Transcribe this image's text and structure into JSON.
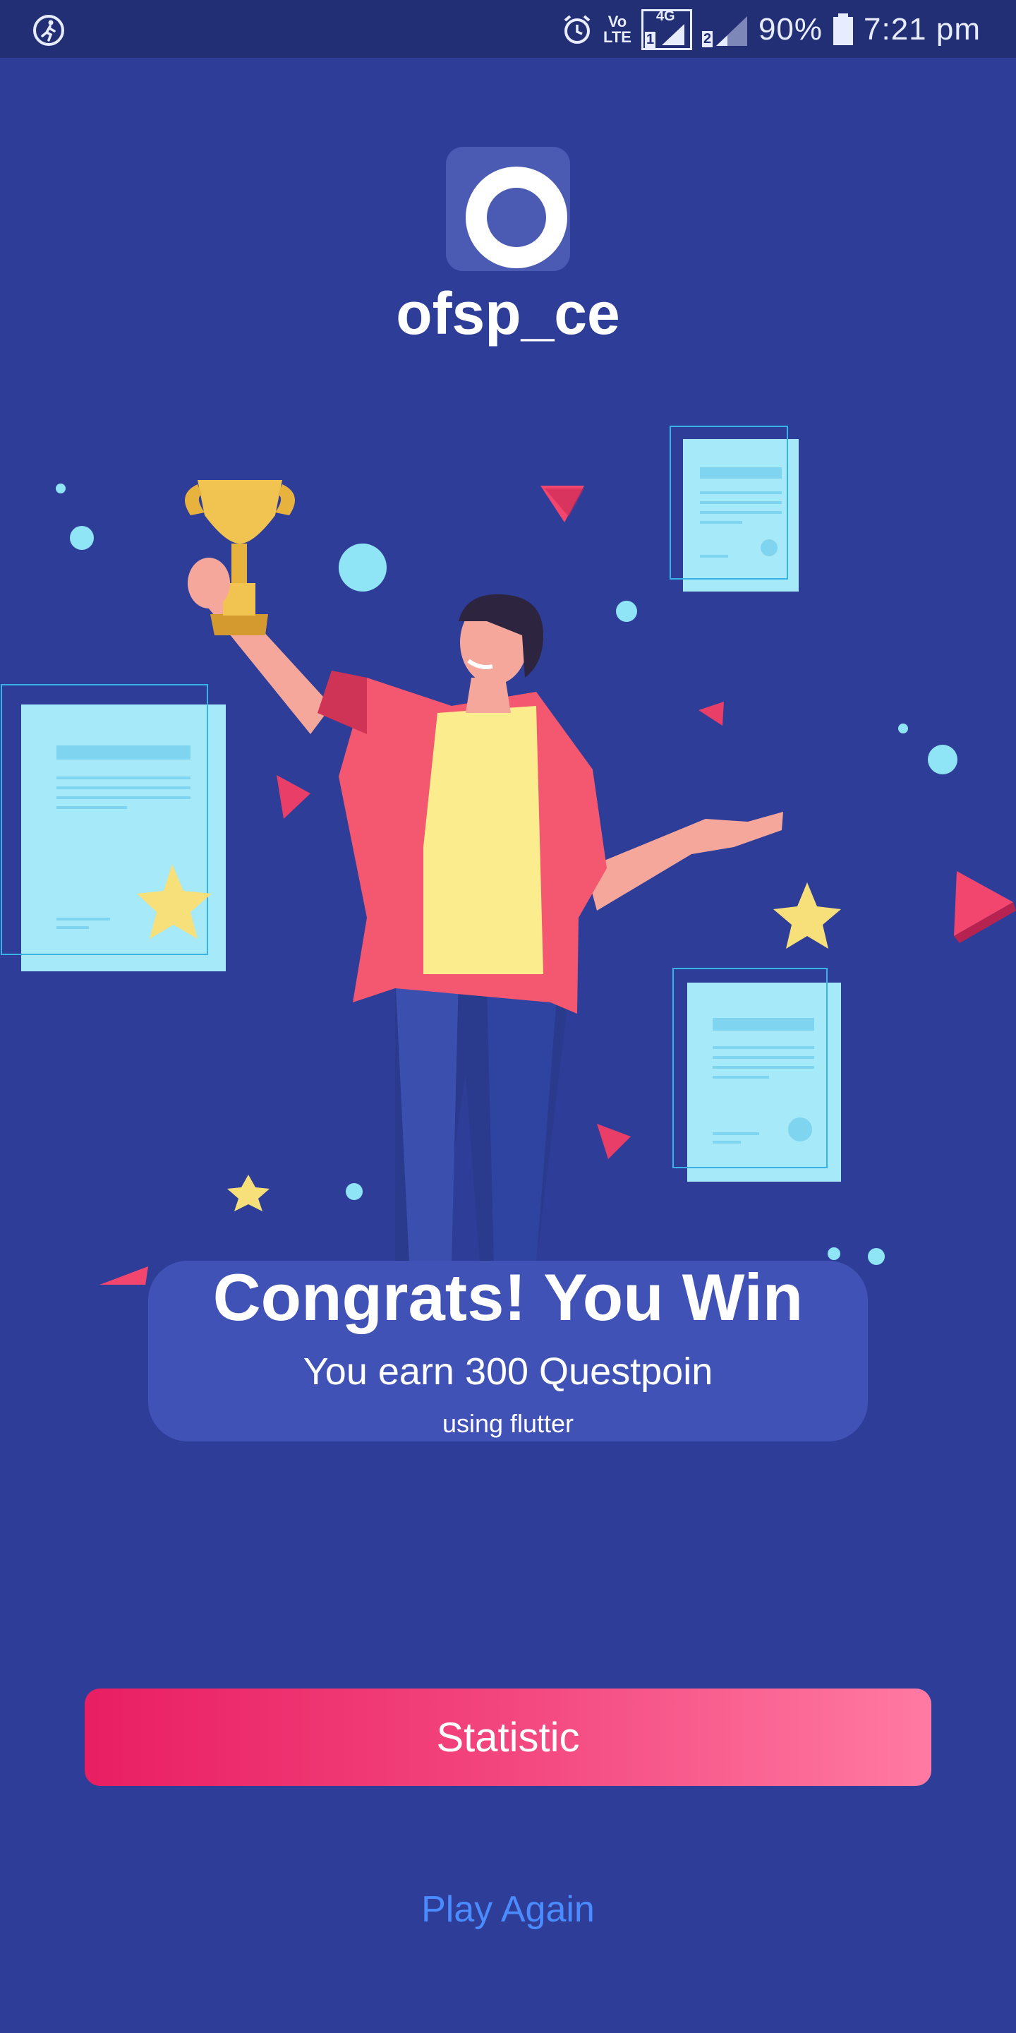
{
  "status_bar": {
    "volte_line1": "Vo",
    "volte_line2": "LTE",
    "network": "4G",
    "sim1": "1",
    "sim2": "2",
    "battery": "90%",
    "time": "7:21 pm"
  },
  "app": {
    "name": "ofsp_ce"
  },
  "result": {
    "title": "Congrats! You Win",
    "subtitle": "You earn 300 Questpoin",
    "note": "using flutter"
  },
  "actions": {
    "statistic_label": "Statistic",
    "play_again_label": "Play Again"
  },
  "colors": {
    "background": "#2e3d98",
    "status_bar": "#232f75",
    "card": "#4152b7",
    "button_gradient_start": "#e91e63",
    "button_gradient_end": "#ff7aa3",
    "link": "#4a8cff"
  }
}
